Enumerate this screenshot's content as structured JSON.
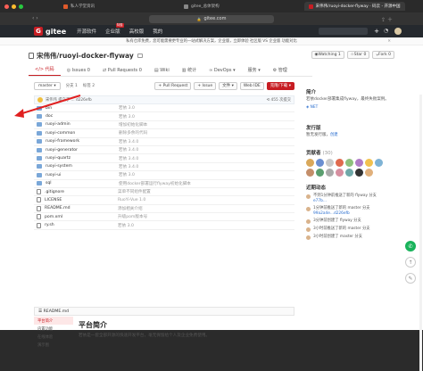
{
  "browser": {
    "tabs": [
      {
        "label": "私人学堂资讯",
        "fav": "#e05a2b"
      },
      {
        "label": "gitee_总体架构",
        "fav": "#888"
      },
      {
        "label": "宋伟伟/ruoyi-docker-flyway · 码云 - 开源中国",
        "fav": "#c71d23"
      }
    ],
    "url": "gitee.com"
  },
  "nav": {
    "logo": "gitee",
    "items": [
      "开源软件",
      "企业版",
      "高校版",
      "我的"
    ],
    "badge": "特惠"
  },
  "notice": {
    "text": "私有仓库免费，您可能需要更专业的一站式解决方案，企业版，立即体验 社区版 VS 企业版 功能对比",
    "close": "✕"
  },
  "repo": {
    "owner": "宋伟伟",
    "sep": " / ",
    "name": "ruoyi-docker-flyway",
    "watch": "Watching",
    "watch_count": "1",
    "star": "Star",
    "star_count": "0",
    "fork": "Fork",
    "fork_count": "0"
  },
  "tabs": [
    {
      "label": "代码",
      "icon": "</>"
    },
    {
      "label": "Issues",
      "count": "0"
    },
    {
      "label": "Pull Requests",
      "count": "0"
    },
    {
      "label": "Wiki"
    },
    {
      "label": "统计"
    },
    {
      "label": "DevOps"
    },
    {
      "label": "服务"
    },
    {
      "label": "管理"
    }
  ],
  "branchbar": {
    "branch": "master",
    "branches": "分支 1",
    "tags": "标签 2",
    "pr_btn": "+ Pull Request",
    "issue_btn": "+ Issue",
    "file_btn": "文件",
    "webide": "Web IDE",
    "clone": "克隆/下载"
  },
  "commit": {
    "text": "宋伟伟 提交于 ... d226efb",
    "count": "455 次提交"
  },
  "files": [
    {
      "name": "bin",
      "type": "folder",
      "msg": "若依 3.0",
      "time": ""
    },
    {
      "name": "doc",
      "type": "folder",
      "msg": "若依 3.0",
      "time": ""
    },
    {
      "name": "ruoyi-admin",
      "type": "folder",
      "msg": "增加初始化脚本",
      "time": ""
    },
    {
      "name": "ruoyi-common",
      "type": "folder",
      "msg": "删除多余的代码",
      "time": ""
    },
    {
      "name": "ruoyi-framework",
      "type": "folder",
      "msg": "若依 3.4.0",
      "time": ""
    },
    {
      "name": "ruoyi-generator",
      "type": "folder",
      "msg": "若依 3.4.0",
      "time": ""
    },
    {
      "name": "ruoyi-quartz",
      "type": "folder",
      "msg": "若依 3.4.0",
      "time": ""
    },
    {
      "name": "ruoyi-system",
      "type": "folder",
      "msg": "若依 3.4.0",
      "time": ""
    },
    {
      "name": "ruoyi-ui",
      "type": "folder",
      "msg": "若依 3.0",
      "time": ""
    },
    {
      "name": "sql",
      "type": "folder",
      "msg": "使用docker部署运行flyway初始化脚本",
      "time": ""
    },
    {
      "name": ".gitignore",
      "type": "file",
      "msg": "菜单不同组件配置",
      "time": ""
    },
    {
      "name": "LICENSE",
      "type": "file",
      "msg": "RuoYi-Vue 1.0",
      "time": ""
    },
    {
      "name": "README.md",
      "type": "file",
      "msg": "添加相关介绍",
      "time": ""
    },
    {
      "name": "pom.xml",
      "type": "file",
      "msg": "升级pom版本号",
      "time": ""
    },
    {
      "name": "ry.sh",
      "type": "file",
      "msg": "若依 3.0",
      "time": ""
    }
  ],
  "readme": {
    "file": "README.md",
    "toc": [
      "平台简介",
      "内置功能",
      "在线体验",
      "演示图"
    ],
    "heading": "平台简介",
    "body": "若依是一套全部开源的快速开发平台，毫无保留给个人及企业免费使用。"
  },
  "sidebar": {
    "intro_title": "简介",
    "intro_text": "若依docker部署集成flyway，最终失败案例。",
    "net": "NET",
    "release_title": "发行版",
    "release_text": "暂无发行版，",
    "release_link": "创建",
    "contrib_title": "贡献者",
    "contrib_count": "(30)",
    "contrib_colors": [
      "#d9a85b",
      "#6b8fd1",
      "#c9c9c9",
      "#e06a4e",
      "#8ec07c",
      "#b07cc6",
      "#f2c14e",
      "#7fb3d5",
      "#c48e6a",
      "#5a9e6f",
      "#aaa",
      "#d68fa0",
      "#6fa8a8",
      "#333",
      "#e0b07c"
    ],
    "activity_title": "近期动态",
    "activities": [
      {
        "text": "不到1分钟前推送了新的 flyway 分支",
        "sub": "e77b...",
        "time": ""
      },
      {
        "text": "1分钟前推送了新的 master 分支",
        "sub": "99a2a4e...d226efb",
        "time": ""
      },
      {
        "text": "3分钟前创建了 flyway 分支",
        "sub": "",
        "time": ""
      },
      {
        "text": "3小时前推送了新的 master 分支",
        "sub": "",
        "time": ""
      },
      {
        "text": "3小时前创建了 master 分支",
        "sub": "",
        "time": ""
      }
    ]
  }
}
